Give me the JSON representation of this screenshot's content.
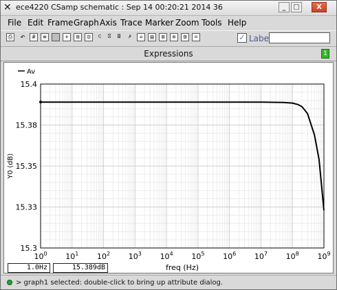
{
  "window": {
    "title": "ece4220 CSamp schematic : Sep 14 00:20:21 2014 36",
    "controls": [
      "_",
      "□",
      "X"
    ]
  },
  "menu": [
    "File",
    "Edit",
    "Frame",
    "Graph",
    "Axis",
    "Trace",
    "Marker",
    "Zoom",
    "Tools",
    "Help"
  ],
  "toolbar": {
    "buttons": [
      "print-icon",
      "undo-icon",
      "grid-icon",
      "strip-icon",
      "fit-icon",
      "zoom-in-icon",
      "zoom-out-icon",
      "zoom-fit-icon",
      "marker-icon",
      "trace-icon",
      "axis-icon",
      "delete-icon"
    ],
    "label_checked": true,
    "label_text": "Label",
    "label_value": ""
  },
  "expressions": {
    "title": "Expressions",
    "badge": "1"
  },
  "chart_data": {
    "type": "line",
    "title": "",
    "xlabel": "freq (Hz)",
    "ylabel": "Y0 (dB)",
    "x_scale": "log",
    "xlim": [
      1,
      1000000000
    ],
    "ylim": [
      15.3,
      15.4
    ],
    "grid": true,
    "legend_position": "top-left",
    "x_ticks": [
      {
        "base": "10",
        "exp": "0"
      },
      {
        "base": "10",
        "exp": "1"
      },
      {
        "base": "10",
        "exp": "2"
      },
      {
        "base": "10",
        "exp": "3"
      },
      {
        "base": "10",
        "exp": "4"
      },
      {
        "base": "10",
        "exp": "5"
      },
      {
        "base": "10",
        "exp": "6"
      },
      {
        "base": "10",
        "exp": "7"
      },
      {
        "base": "10",
        "exp": "8"
      },
      {
        "base": "10",
        "exp": "9"
      }
    ],
    "y_ticks": [
      "15.4",
      "15.38",
      "15.35",
      "15.33",
      "15.3"
    ],
    "series": [
      {
        "name": "Av",
        "color": "#000000",
        "x": [
          1,
          10,
          100,
          1000,
          10000,
          100000,
          1000000,
          10000000,
          50000000,
          100000000,
          150000000,
          200000000,
          300000000,
          500000000,
          700000000,
          1000000000
        ],
        "y": [
          15.389,
          15.389,
          15.389,
          15.389,
          15.389,
          15.389,
          15.389,
          15.389,
          15.3888,
          15.3884,
          15.3875,
          15.3862,
          15.382,
          15.369,
          15.354,
          15.323
        ]
      }
    ]
  },
  "readouts": {
    "x": "1.0Hz",
    "y": "15.389dB"
  },
  "status": {
    "text": "> graph1 selected: double-click to bring up attribute dialog."
  }
}
